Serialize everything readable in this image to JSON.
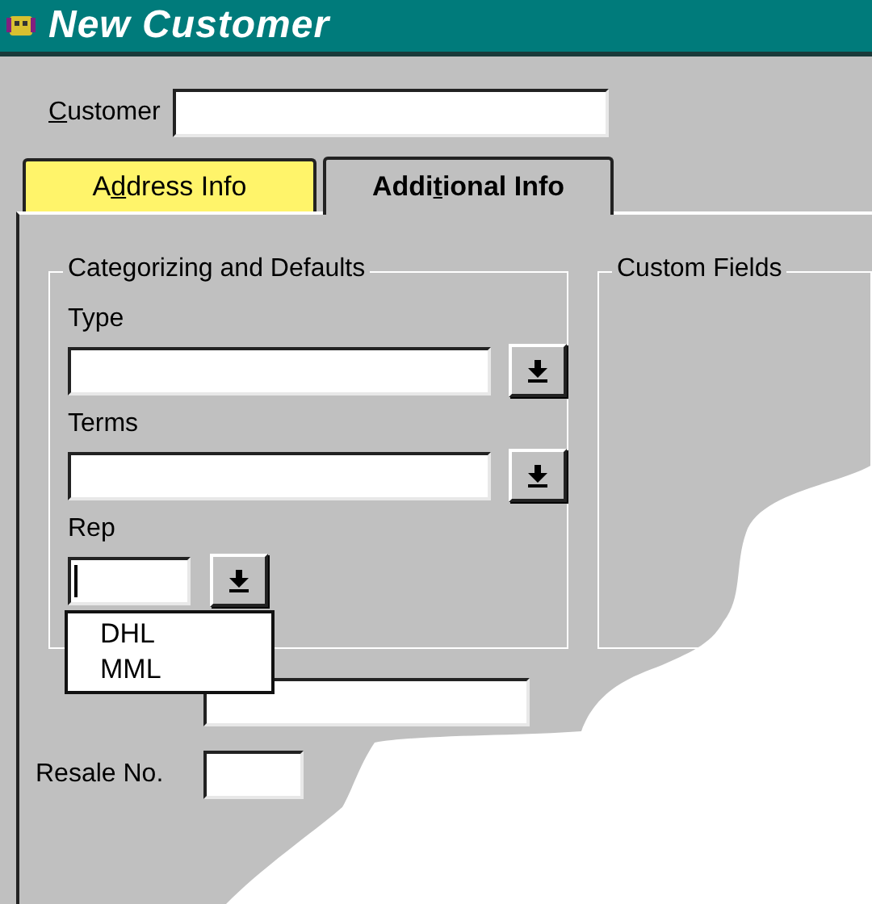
{
  "window": {
    "title": "New Customer"
  },
  "customer": {
    "label": {
      "key": "C",
      "after": "ustomer"
    }
  },
  "tabs": [
    {
      "label": {
        "before": "A",
        "key": "d",
        "after": "dress Info"
      },
      "selected": false
    },
    {
      "label": {
        "before": "Addi",
        "key": "t",
        "after": "ional Info"
      },
      "selected": true
    }
  ],
  "categorizing": {
    "title": "Categorizing and Defaults",
    "fields": [
      {
        "label": "Type",
        "kind": "wide"
      },
      {
        "label": "Terms",
        "kind": "wide"
      },
      {
        "label": "Rep",
        "kind": "narrow",
        "open": true
      }
    ]
  },
  "rep_list": {
    "options": [
      "DHL",
      "MML"
    ]
  },
  "custom_fields": {
    "title": "Custom Fields"
  },
  "bottom_fields": [
    {
      "kind": "wide"
    },
    {
      "label": "Resale No.",
      "kind": "short"
    }
  ]
}
